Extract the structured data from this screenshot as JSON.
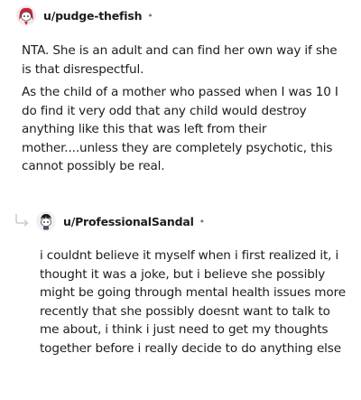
{
  "comment": {
    "username": "u/pudge-thefish",
    "avatar_icon": "snoo-avatar-red-hair-icon",
    "separator": "•",
    "paragraphs": [
      "NTA. She is an adult and can find her own way if she is that disrespectful.",
      "As the child of a mother who passed when I was 10 I do find it very odd that any child would destroy anything like this that was left from their mother....unless they are completely psychotic, this cannot possibly be real."
    ]
  },
  "reply": {
    "reply_icon": "reply-arrow-icon",
    "username": "u/ProfessionalSandal",
    "avatar_icon": "snoo-avatar-black-hair-icon",
    "separator": "•",
    "text": "i couldnt believe it myself when i first realized it, i thought it was a joke, but i believe she possibly might be going through mental health issues more recently that she possibly doesnt want to talk to me about, i think i just need to get my thoughts together before i really decide to do anything else"
  },
  "colors": {
    "text": "#1c1c1c",
    "muted": "#7c7c7c",
    "background": "#ffffff"
  }
}
